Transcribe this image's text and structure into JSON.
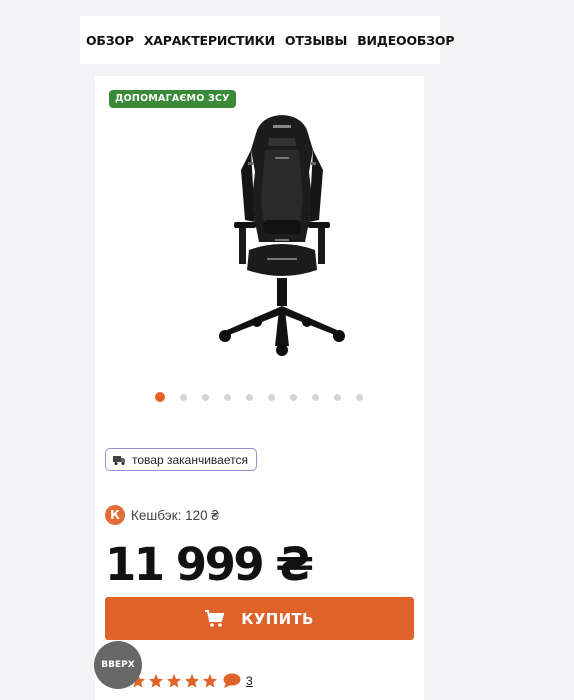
{
  "tabs": [
    {
      "label": "ОБЗОР"
    },
    {
      "label": "ХАРАКТЕРИСТИКИ"
    },
    {
      "label": "ОТЗЫВЫ"
    },
    {
      "label": "ВИДЕООБЗОР"
    }
  ],
  "product": {
    "badge": "ДОПОМАГАЄМО ЗСУ",
    "image_icon": "gaming-chair-image",
    "gallery": {
      "total": 10,
      "active_index": 1
    },
    "stock_status": "товар заканчивается",
    "cashback_logo": "К",
    "cashback": "Кешбэк: 120 ₴",
    "price": "11 999 ₴",
    "buy_label": "КУПИТЬ",
    "rating": 5,
    "reviews_count": "3"
  },
  "scroll_top_label": "ВВЕРХ",
  "colors": {
    "accent": "#e0622b",
    "badge_green": "#3a8a3a",
    "stock_border": "#9a8ed0",
    "star": "#e0622b"
  }
}
